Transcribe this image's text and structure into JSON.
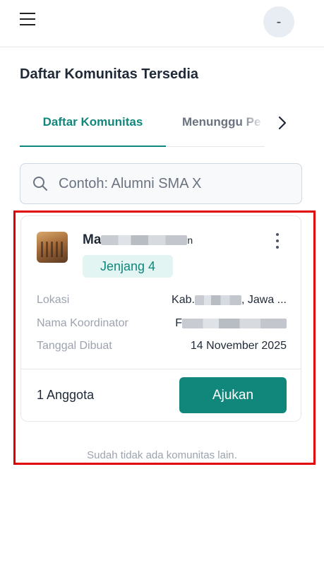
{
  "header": {
    "menu_icon": "hamburger-menu-icon",
    "avatar_text": "-"
  },
  "page": {
    "title": "Daftar Komunitas Tersedia"
  },
  "tabs": [
    {
      "label": "Daftar Komunitas",
      "active": true
    },
    {
      "label": "Menunggu Pe",
      "active": false
    }
  ],
  "search": {
    "placeholder": "Contoh: Alumni SMA X",
    "value": ""
  },
  "community_card": {
    "name_visible_prefix": "Ma",
    "name_visible_suffix": "n",
    "level_badge": "Jenjang 4",
    "location_label": "Lokasi",
    "location_prefix": "Kab.",
    "location_suffix": ", Jawa ...",
    "coordinator_label": "Nama Koordinator",
    "coordinator_prefix": "F",
    "created_label": "Tanggal Dibuat",
    "created_value": "14 November 2025",
    "members": "1 Anggota",
    "apply_label": "Ajukan"
  },
  "end_note": "Sudah tidak ada komunitas lain.",
  "colors": {
    "accent": "#11877c",
    "badge_bg": "#e3f5f2",
    "highlight": "#e00000"
  }
}
